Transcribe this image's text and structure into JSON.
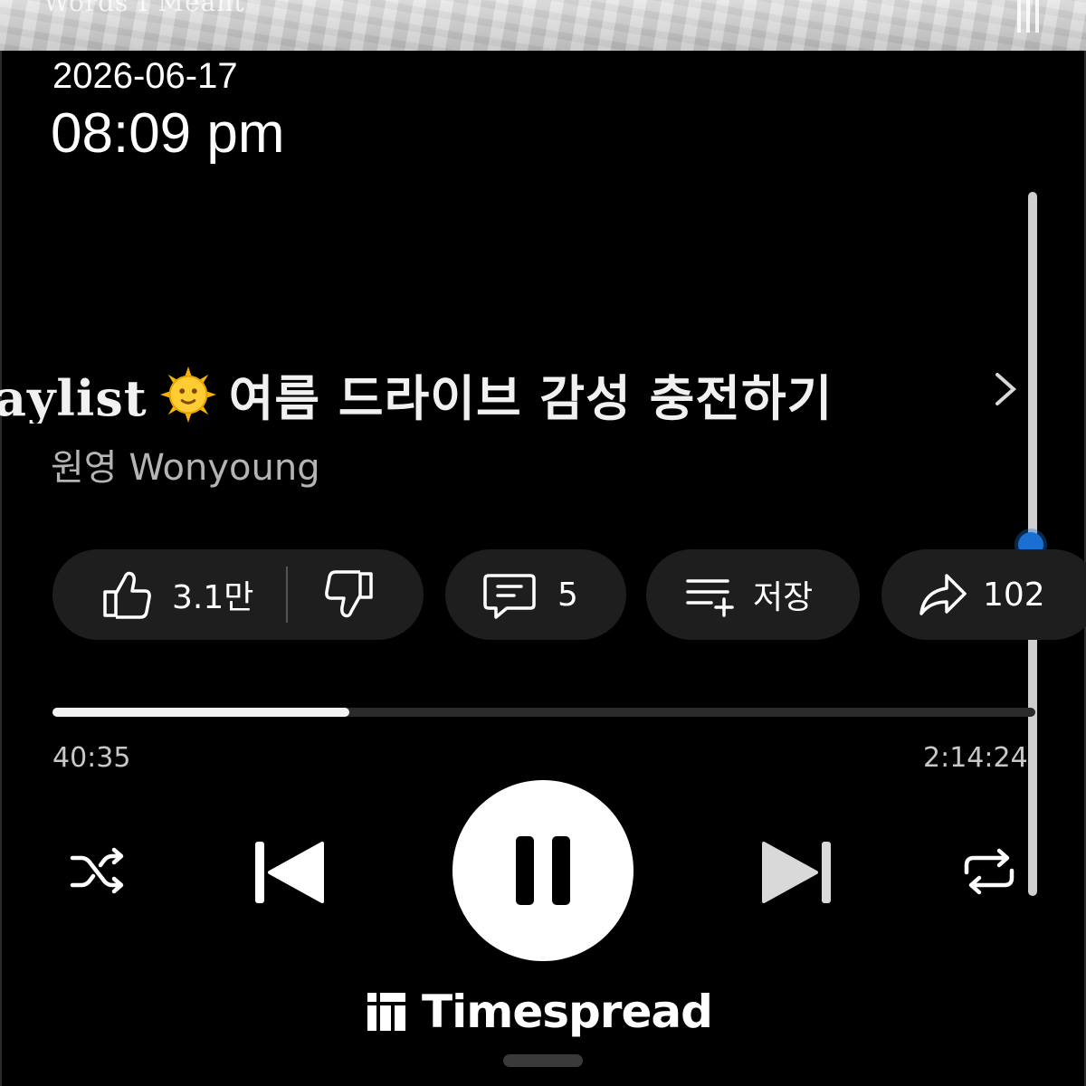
{
  "top_strip": {
    "text": "Words I Meant"
  },
  "status": {
    "date": "2026-06-17",
    "time": "08:09 pm"
  },
  "video": {
    "title_lead": "aylist",
    "title_emoji": "sun-with-face",
    "title_main": "여름 드라이브 감성 충전하기",
    "channel": "원영 Wonyoung"
  },
  "actions": {
    "like_count": "3.1만",
    "comment_count": "5",
    "save_label": "저장",
    "share_count": "102"
  },
  "player": {
    "elapsed": "40:35",
    "total": "2:14:24",
    "progress_fraction": 0.302,
    "state": "playing"
  },
  "scroll": {
    "position_fraction": 0.48
  },
  "brand": {
    "name": "Timespread"
  },
  "colors": {
    "background": "#000000",
    "accent": "#1a6fd1",
    "pill": "#1e1e1e"
  }
}
